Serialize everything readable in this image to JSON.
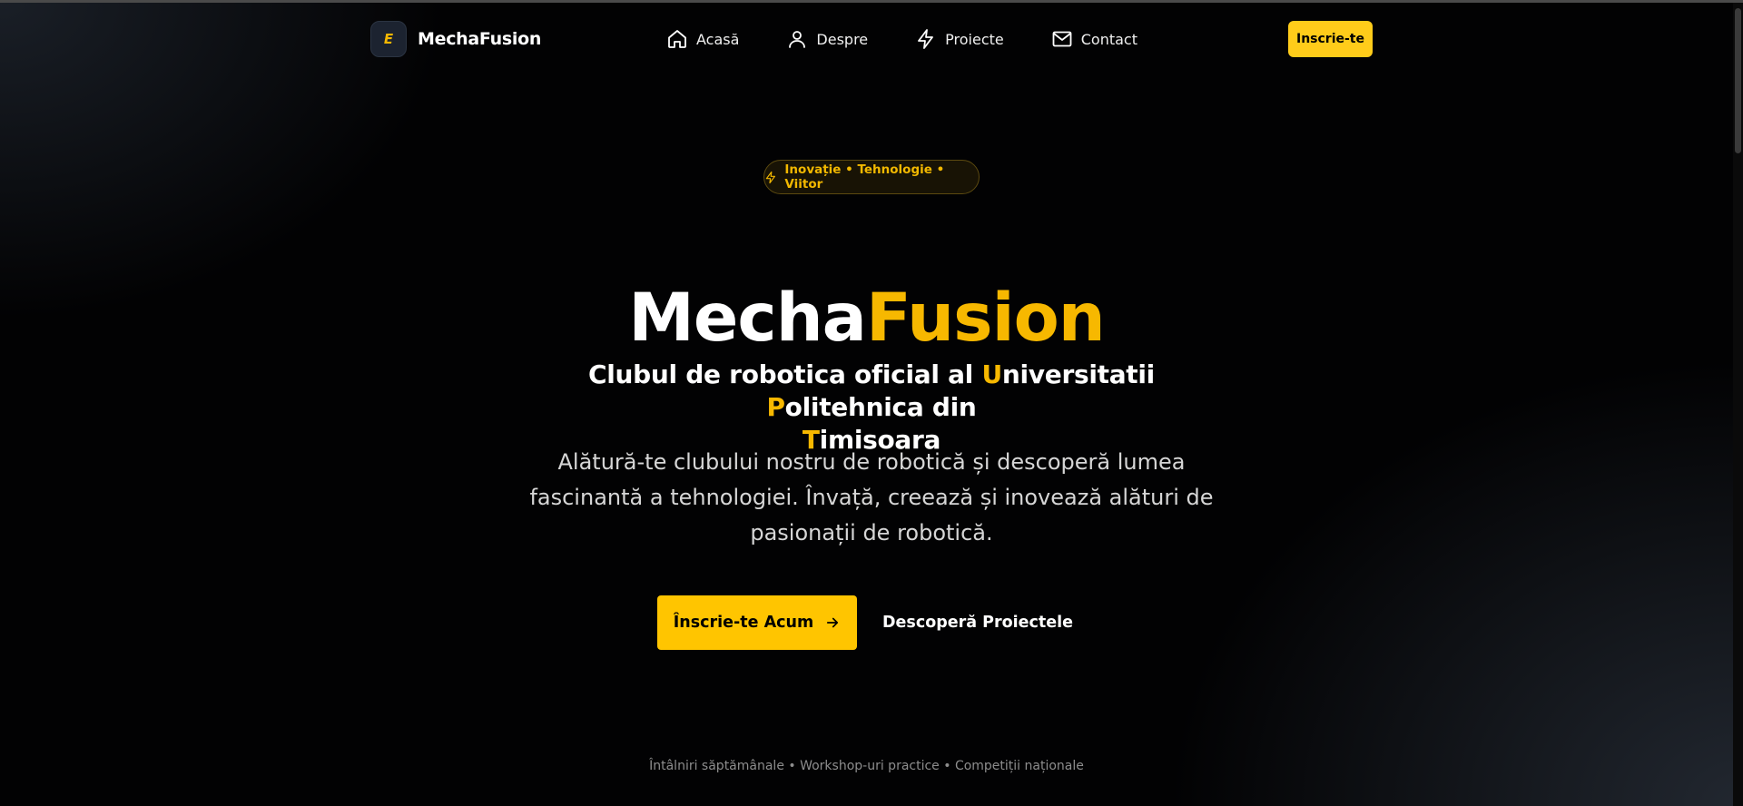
{
  "brand": {
    "logo_glyph": "E",
    "name": "MechaFusion"
  },
  "nav": {
    "items": [
      {
        "label": "Acasă",
        "icon": "home-icon"
      },
      {
        "label": "Despre",
        "icon": "user-icon"
      },
      {
        "label": "Proiecte",
        "icon": "lightning-icon"
      },
      {
        "label": "Contact",
        "icon": "mail-icon"
      }
    ],
    "signup_label": "Inscrie-te"
  },
  "badge": {
    "text": "Inovație • Tehnologie • Viitor",
    "icon": "lightning-icon"
  },
  "hero": {
    "title_part1": "Mecha",
    "title_part2": "Fusion",
    "subtitle": {
      "t1": "Clubul de robotica oficial al ",
      "u": "U",
      "t2": "niversitatii ",
      "p": "P",
      "t3": "olitehnica din ",
      "t": "T",
      "t4": "imisoara"
    },
    "description": "Alătură-te clubului nostru de robotică și descoperă lumea fascinantă a tehnologiei. Învață, creează și inovează alături de pasionații de robotică.",
    "cta_primary": "Înscrie-te Acum",
    "cta_secondary": "Descoperă Proiectele"
  },
  "footer_note": "Întâlniri săptămânale • Workshop-uri practice • Competiții naționale",
  "colors": {
    "accent": "#ffc500",
    "background": "#020203"
  }
}
